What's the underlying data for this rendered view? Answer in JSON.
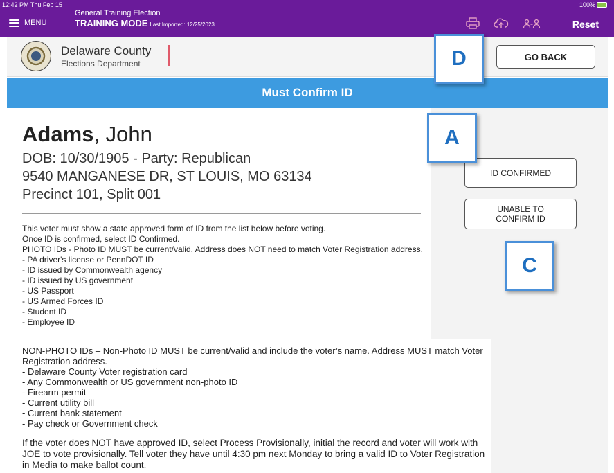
{
  "status_bar": {
    "time": "12:42 PM  Thu Feb 15",
    "battery": "100%"
  },
  "topbar": {
    "menu_label": "MENU",
    "election_name": "General Training Election",
    "mode": "TRAINING MODE",
    "last_imported": "Last Imported: 12/25/2023",
    "reset_label": "Reset",
    "icons": [
      "printer-icon",
      "cloud-upload-icon",
      "users-sync-icon"
    ]
  },
  "header": {
    "org_name": "Delaware County",
    "org_dept": "Elections Department",
    "go_back_label": "GO BACK"
  },
  "page_title": "Must Confirm ID",
  "voter": {
    "last_name": "Adams",
    "first_name": ", John",
    "dob_party": "DOB: 10/30/1905 - Party: Republican",
    "address": "9540 MANGANESE DR, ST LOUIS, MO 63134",
    "precinct": "Precinct 101, Split 001"
  },
  "instructions": {
    "photo": "This voter must show a state approved form of ID from the list below before voting.\nOnce ID is confirmed, select ID Confirmed.\nPHOTO IDs - Photo ID MUST be current/valid. Address does NOT need to match Voter Registration address.\n- PA driver's license or PennDOT ID\n- ID issued by Commonwealth agency\n- ID issued by US government\n- US Passport\n- US Armed Forces ID\n- Student ID\n- Employee ID",
    "non_photo": "NON-PHOTO IDs – Non-Photo ID MUST be current/valid and include the voter’s name. Address MUST match Voter Registration address.\n- Delaware County Voter registration card\n- Any Commonwealth or US government non-photo ID\n- Firearm permit\n- Current utility bill\n- Current bank statement\n- Pay check or Government check",
    "notice": "If the voter does NOT have approved ID, select Process Provisionally, initial the record and voter will work with JOE to vote provisionally. Tell voter they have until 4:30 pm next Monday to bring a valid ID to Voter Registration in Media to make ballot count."
  },
  "actions": {
    "id_confirmed_label": "ID CONFIRMED",
    "unable_label": "UNABLE TO\nCONFIRM ID"
  },
  "callouts": {
    "d": "D",
    "a": "A",
    "c": "C"
  },
  "colors": {
    "topbar": "#6a1b9a",
    "title_band": "#3d9be0",
    "callout_border": "#4a90d9"
  }
}
